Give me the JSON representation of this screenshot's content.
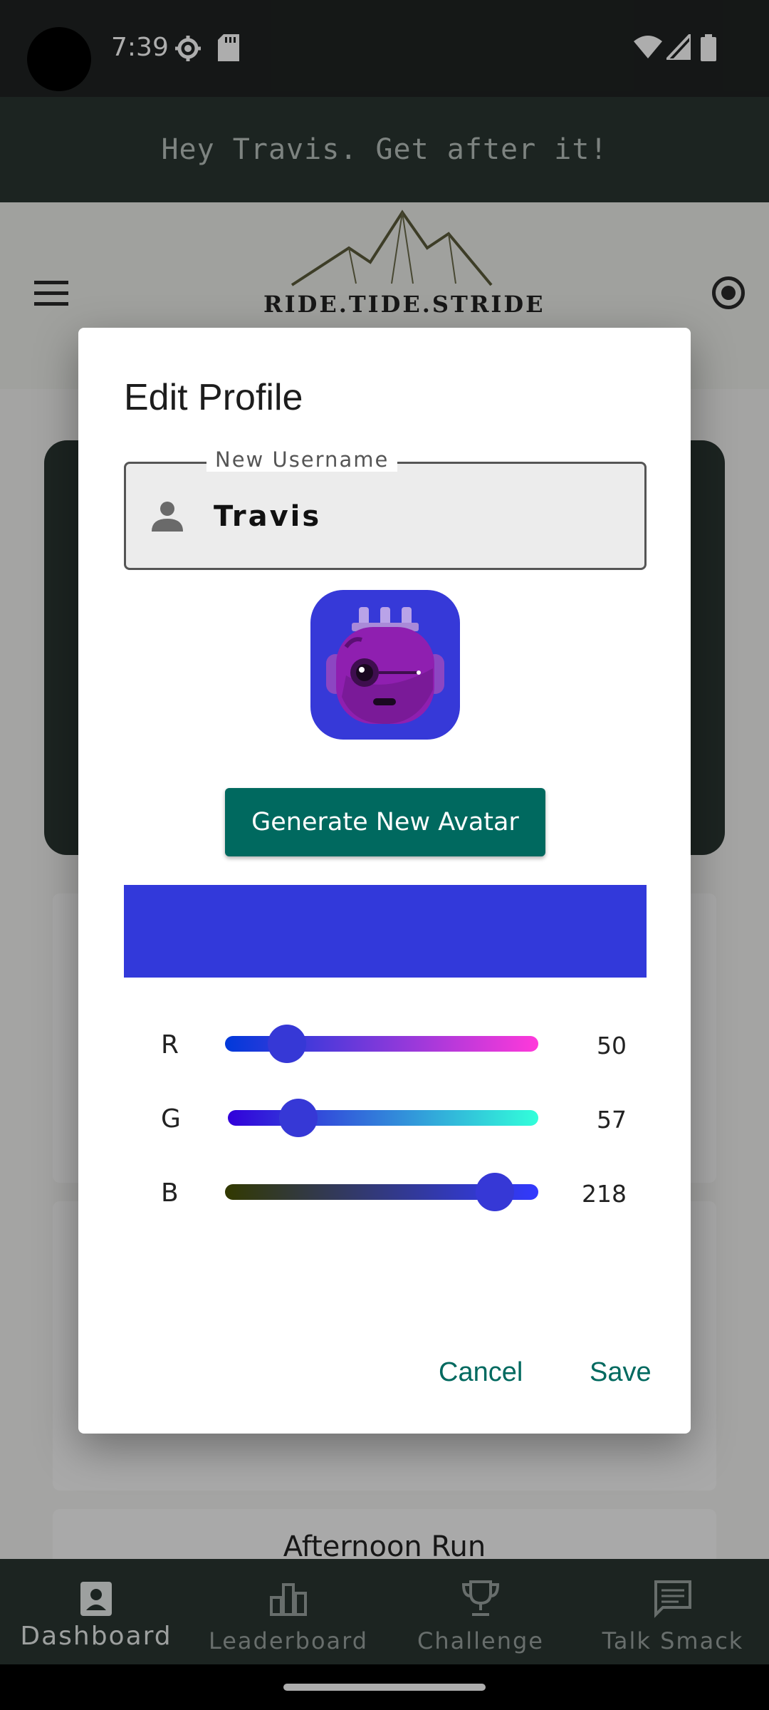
{
  "status_bar": {
    "time": "7:39"
  },
  "greeting": "Hey Travis. Get after it!",
  "header": {
    "logo_text": "RIDE.TIDE.STRIDE"
  },
  "background": {
    "card_title": "Afternoon Run"
  },
  "nav": {
    "items": [
      {
        "label": "Dashboard",
        "icon": "account-box-icon",
        "active": true
      },
      {
        "label": "Leaderboard",
        "icon": "leaderboard-icon",
        "active": false
      },
      {
        "label": "Challenge",
        "icon": "trophy-icon",
        "active": false
      },
      {
        "label": "Talk Smack",
        "icon": "chat-icon",
        "active": false
      }
    ]
  },
  "dialog": {
    "title": "Edit Profile",
    "username_label": "New Username",
    "username_value": "Travis",
    "generate_button": "Generate New Avatar",
    "color_hex": "#3239da",
    "sliders": [
      {
        "label": "R",
        "value": "50",
        "max": 255
      },
      {
        "label": "G",
        "value": "57",
        "max": 255
      },
      {
        "label": "B",
        "value": "218",
        "max": 255
      }
    ],
    "cancel": "Cancel",
    "save": "Save"
  },
  "colors": {
    "accent": "#00695f",
    "status_bar": "#1f2322",
    "nav": "#2a3532"
  }
}
